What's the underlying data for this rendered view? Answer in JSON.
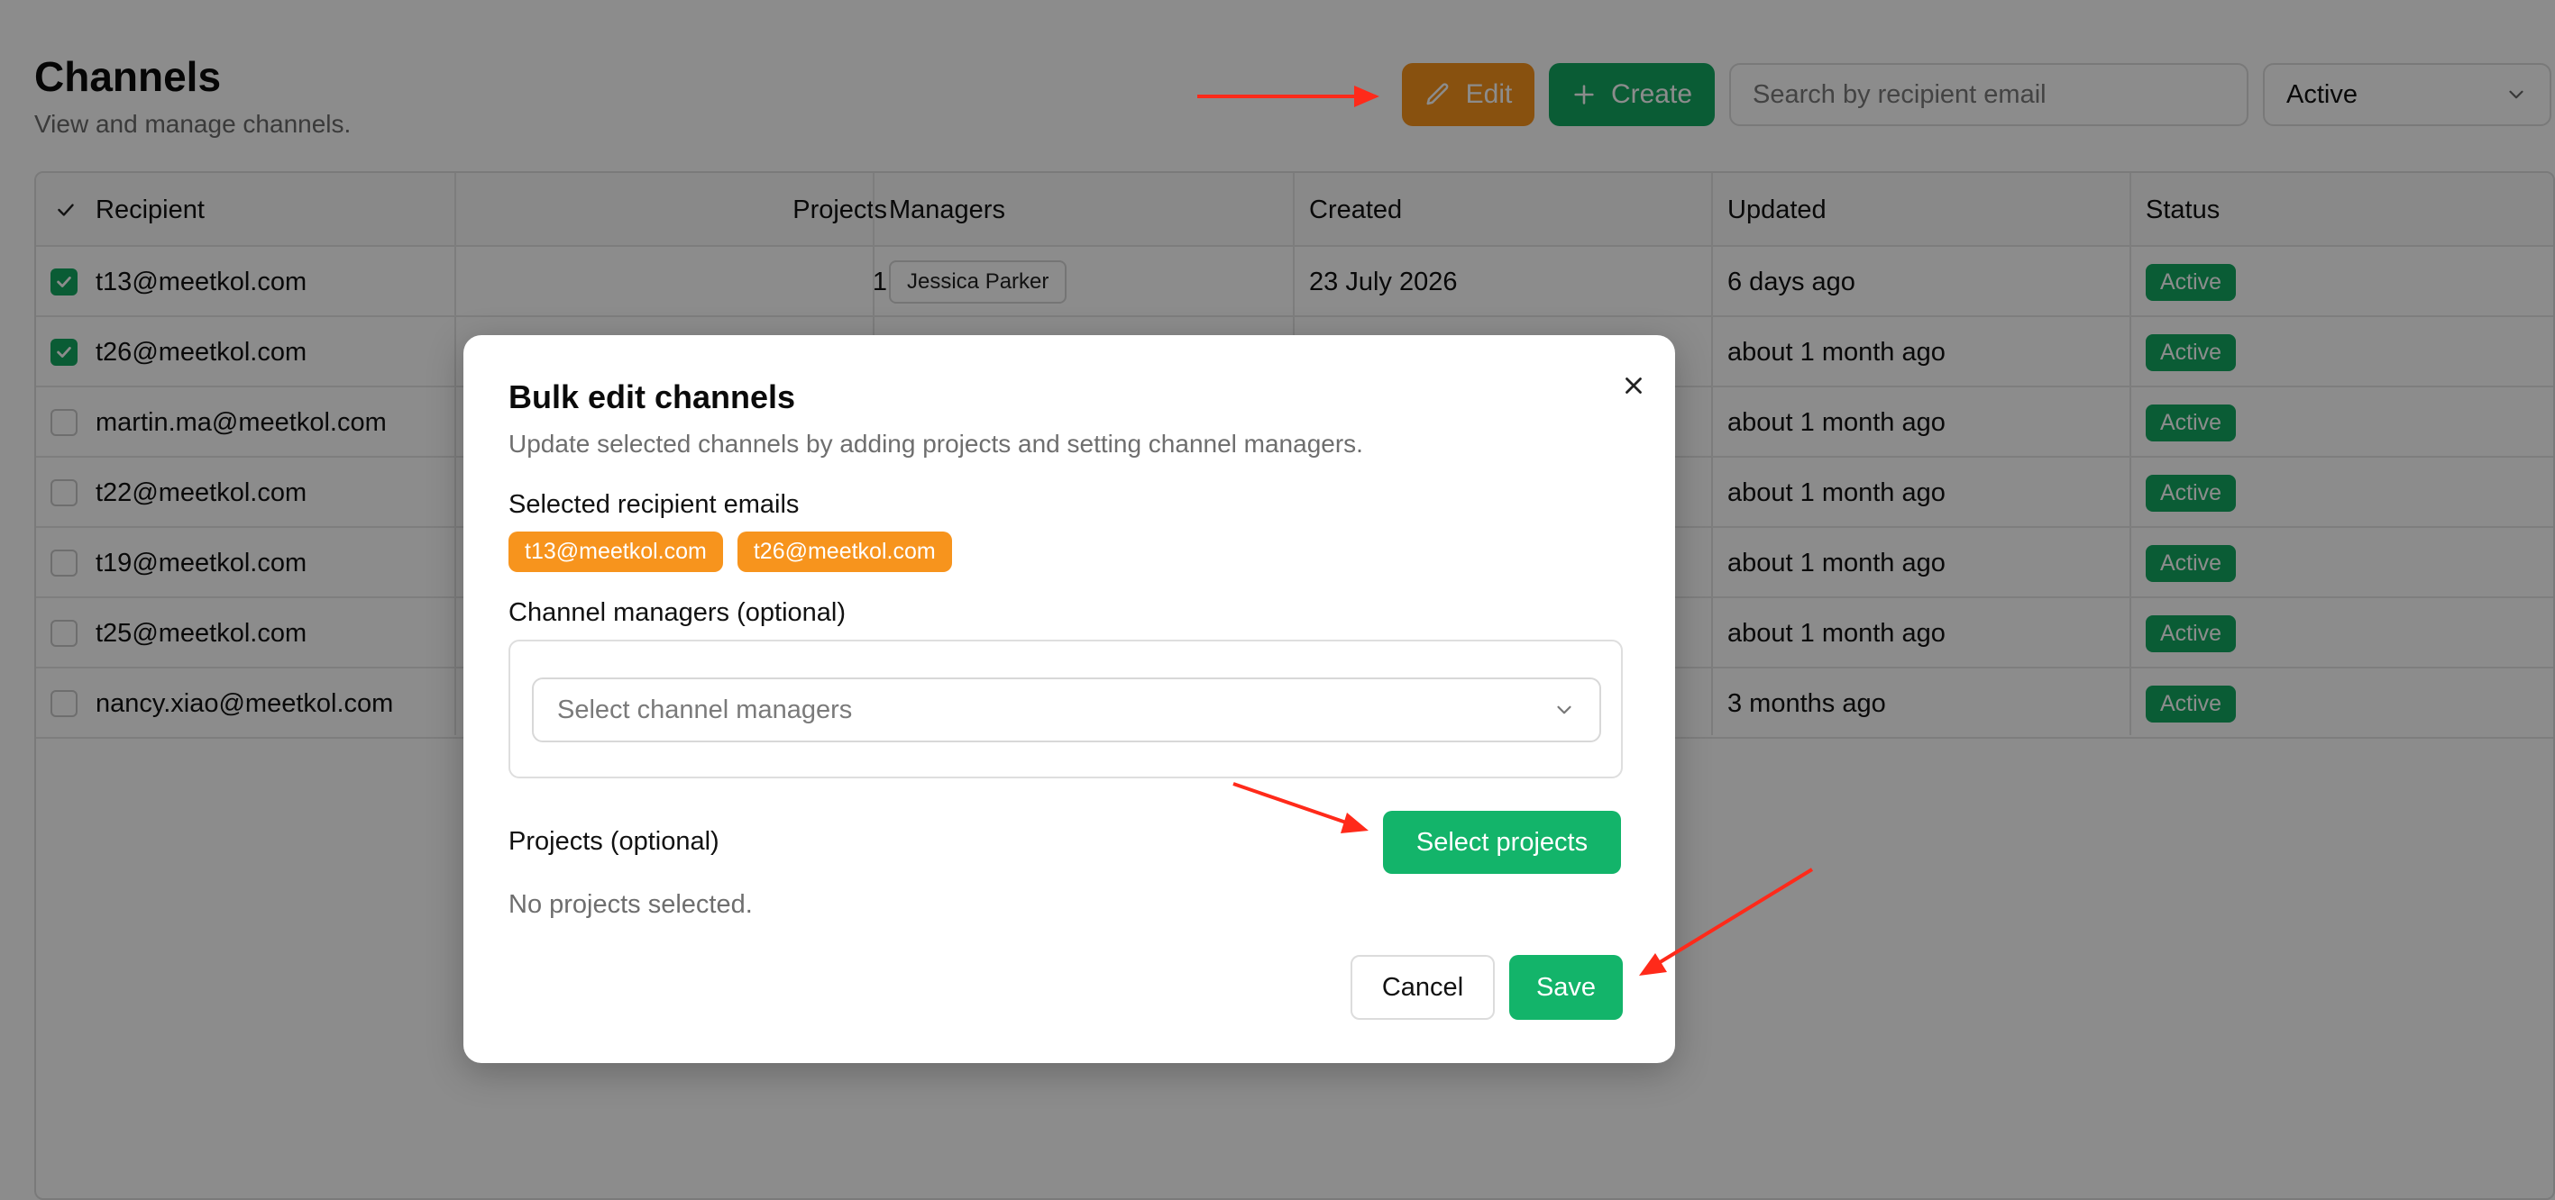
{
  "header": {
    "title": "Channels",
    "subtitle": "View and manage channels.",
    "edit_label": "Edit",
    "create_label": "Create",
    "search_placeholder": "Search by recipient email",
    "status_filter": "Active"
  },
  "table": {
    "columns": [
      "Recipient",
      "Projects",
      "Managers",
      "Created",
      "Updated",
      "Status"
    ],
    "rows": [
      {
        "recipient": "t13@meetkol.com",
        "checked": true,
        "projects": "1",
        "manager": "Jessica Parker",
        "created": "23 July 2026",
        "updated": "6 days ago",
        "status": "Active"
      },
      {
        "recipient": "t26@meetkol.com",
        "checked": true,
        "projects": "",
        "manager": "",
        "created": "",
        "updated": "about 1 month ago",
        "status": "Active"
      },
      {
        "recipient": "martin.ma@meetkol.com",
        "checked": false,
        "projects": "",
        "manager": "",
        "created": "",
        "updated": "about 1 month ago",
        "status": "Active"
      },
      {
        "recipient": "t22@meetkol.com",
        "checked": false,
        "projects": "",
        "manager": "",
        "created": "",
        "updated": "about 1 month ago",
        "status": "Active"
      },
      {
        "recipient": "t19@meetkol.com",
        "checked": false,
        "projects": "",
        "manager": "",
        "created": "",
        "updated": "about 1 month ago",
        "status": "Active"
      },
      {
        "recipient": "t25@meetkol.com",
        "checked": false,
        "projects": "",
        "manager": "",
        "created": "",
        "updated": "about 1 month ago",
        "status": "Active"
      },
      {
        "recipient": "nancy.xiao@meetkol.com",
        "checked": false,
        "projects": "",
        "manager": "",
        "created": "",
        "updated": "3 months ago",
        "status": "Active"
      }
    ]
  },
  "modal": {
    "title": "Bulk edit channels",
    "description": "Update selected channels by adding projects and setting channel managers.",
    "selected_label": "Selected recipient emails",
    "selected_emails": [
      "t13@meetkol.com",
      "t26@meetkol.com"
    ],
    "managers_label": "Channel managers (optional)",
    "managers_placeholder": "Select channel managers",
    "projects_label": "Projects (optional)",
    "select_projects_label": "Select projects",
    "no_projects_text": "No projects selected.",
    "cancel_label": "Cancel",
    "save_label": "Save"
  },
  "colors": {
    "accent_green": "#13a862",
    "accent_orange": "#f7941d",
    "annotation_red": "#ff2a1a"
  },
  "icons": {
    "edit": "pencil-icon",
    "create": "plus-icon",
    "status": "chevron-down-icon",
    "close": "close-icon",
    "check": "check-icon"
  }
}
